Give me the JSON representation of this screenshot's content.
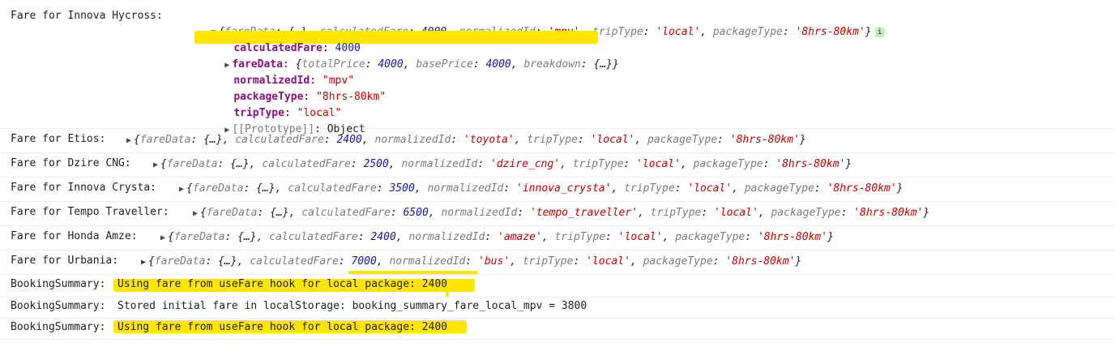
{
  "innova_hycross": {
    "prefix": "Fare for Innova Hycross: ",
    "summary": {
      "k1": "fareData",
      "v1": "{…}",
      "k2": "calculatedFare",
      "v2": "4000",
      "k3": "normalizedId",
      "v3": "'mpv'",
      "k4": "tripType",
      "v4": "'local'",
      "k5": "packageType",
      "v5": "'8hrs-80km'"
    },
    "info_badge": "i",
    "expanded": {
      "calculatedFare_key": "calculatedFare",
      "calculatedFare_val": "4000",
      "fareData_key": "fareData",
      "fareData_k1": "totalPrice",
      "fareData_v1": "4000",
      "fareData_k2": "basePrice",
      "fareData_v2": "4000",
      "fareData_k3": "breakdown",
      "fareData_v3": "{…}",
      "normalizedId_key": "normalizedId",
      "normalizedId_val": "\"mpv\"",
      "packageType_key": "packageType",
      "packageType_val": "\"8hrs-80km\"",
      "tripType_key": "tripType",
      "tripType_val": "\"local\"",
      "prototype_key": "[[Prototype]]",
      "prototype_val": "Object"
    }
  },
  "logs": [
    {
      "prefix": "Fare for Etios: ",
      "fare": "2400",
      "id": "'toyota'",
      "trip": "'local'",
      "pkg": "'8hrs-80km'"
    },
    {
      "prefix": "Fare for Dzire CNG: ",
      "fare": "2500",
      "id": "'dzire_cng'",
      "trip": "'local'",
      "pkg": "'8hrs-80km'"
    },
    {
      "prefix": "Fare for Innova Crysta: ",
      "fare": "3500",
      "id": "'innova_crysta'",
      "trip": "'local'",
      "pkg": "'8hrs-80km'"
    },
    {
      "prefix": "Fare for Tempo Traveller: ",
      "fare": "6500",
      "id": "'tempo_traveller'",
      "trip": "'local'",
      "pkg": "'8hrs-80km'"
    },
    {
      "prefix": "Fare for Honda Amze: ",
      "fare": "2400",
      "id": "'amaze'",
      "trip": "'local'",
      "pkg": "'8hrs-80km'"
    },
    {
      "prefix": "Fare for Urbania: ",
      "fare": "7000",
      "id": "'bus'",
      "trip": "'local'",
      "pkg": "'8hrs-80km'"
    }
  ],
  "obj_keys": {
    "fareData": "fareData",
    "fareData_val": "{…}",
    "calculatedFare": "calculatedFare",
    "normalizedId": "normalizedId",
    "tripType": "tripType",
    "packageType": "packageType"
  },
  "booking": [
    {
      "prefix": "BookingSummary: ",
      "text": "Using fare from useFare hook for local package: 2400"
    },
    {
      "prefix": "BookingSummary: ",
      "text": "Stored initial fare in localStorage: booking_summary_fare_local_mpv = 3800"
    },
    {
      "prefix": "BookingSummary: ",
      "text": "Using fare from useFare hook for local package: 2400"
    }
  ],
  "colors": {
    "highlight": "#ffe600",
    "number": "#1a1aa6",
    "string": "#c80000",
    "property": "#881280"
  }
}
